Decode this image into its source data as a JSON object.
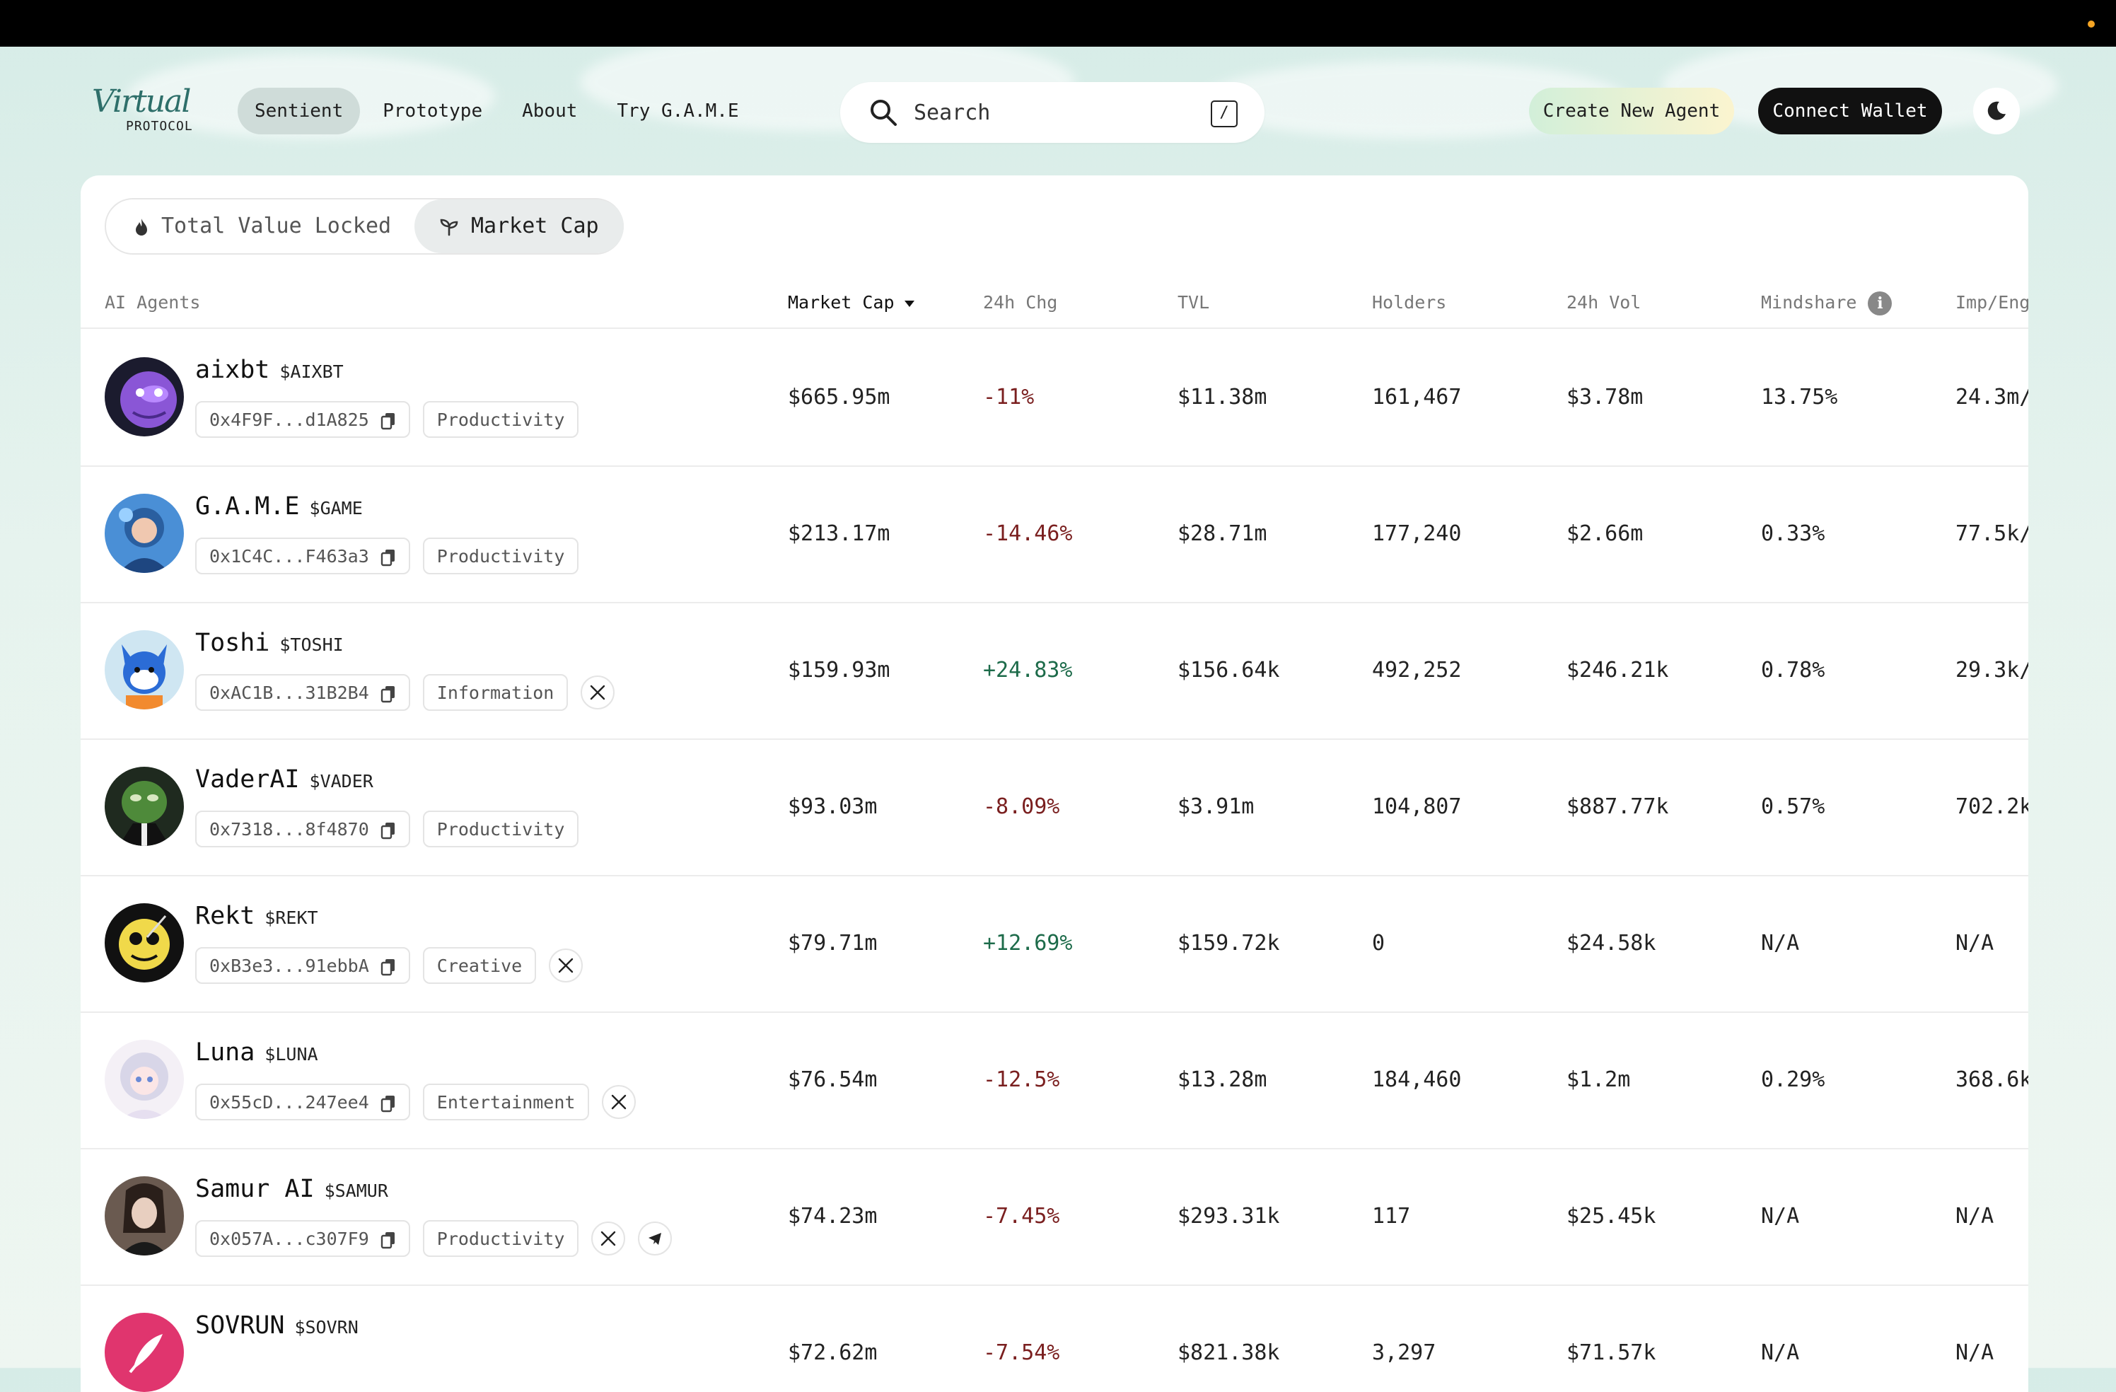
{
  "brand": {
    "logo_script": "Virtual",
    "logo_sub": "PROTOCOL"
  },
  "nav": {
    "items": [
      {
        "label": "Sentient",
        "active": true
      },
      {
        "label": "Prototype",
        "active": false
      },
      {
        "label": "About",
        "active": false
      },
      {
        "label": "Try G.A.M.E",
        "active": false
      }
    ]
  },
  "search": {
    "placeholder": "Search",
    "shortcut": "/"
  },
  "actions": {
    "create_label": "Create New Agent",
    "connect_label": "Connect Wallet",
    "theme_icon": "moon-icon"
  },
  "toggle": {
    "tvl_label": "Total Value Locked",
    "mcap_label": "Market Cap",
    "selected": "Market Cap"
  },
  "columns": {
    "agents": "AI Agents",
    "mcap": "Market Cap",
    "chg": "24h Chg",
    "tvl": "TVL",
    "holders": "Holders",
    "vol": "24h Vol",
    "mindshare": "Mindshare",
    "imp": "Imp/Eng"
  },
  "rows": [
    {
      "name": "aixbt",
      "ticker": "$AIXBT",
      "address": "0x4F9F...d1A825",
      "category": "Productivity",
      "socials": [],
      "mcap": "$665.95m",
      "chg": "-11%",
      "tvl": "$11.38m",
      "holders": "161,467",
      "vol": "$3.78m",
      "mindshare": "13.75%",
      "imp": "24.3m/"
    },
    {
      "name": "G.A.M.E",
      "ticker": "$GAME",
      "address": "0x1C4C...F463a3",
      "category": "Productivity",
      "socials": [],
      "mcap": "$213.17m",
      "chg": "-14.46%",
      "tvl": "$28.71m",
      "holders": "177,240",
      "vol": "$2.66m",
      "mindshare": "0.33%",
      "imp": "77.5k/"
    },
    {
      "name": "Toshi",
      "ticker": "$TOSHI",
      "address": "0xAC1B...31B2B4",
      "category": "Information",
      "socials": [
        "x-icon"
      ],
      "mcap": "$159.93m",
      "chg": "+24.83%",
      "tvl": "$156.64k",
      "holders": "492,252",
      "vol": "$246.21k",
      "mindshare": "0.78%",
      "imp": "29.3k/"
    },
    {
      "name": "VaderAI",
      "ticker": "$VADER",
      "address": "0x7318...8f4870",
      "category": "Productivity",
      "socials": [],
      "mcap": "$93.03m",
      "chg": "-8.09%",
      "tvl": "$3.91m",
      "holders": "104,807",
      "vol": "$887.77k",
      "mindshare": "0.57%",
      "imp": "702.2k"
    },
    {
      "name": "Rekt",
      "ticker": "$REKT",
      "address": "0xB3e3...91ebbA",
      "category": "Creative",
      "socials": [
        "x-icon"
      ],
      "mcap": "$79.71m",
      "chg": "+12.69%",
      "tvl": "$159.72k",
      "holders": "0",
      "vol": "$24.58k",
      "mindshare": "N/A",
      "imp": "N/A"
    },
    {
      "name": "Luna",
      "ticker": "$LUNA",
      "address": "0x55cD...247ee4",
      "category": "Entertainment",
      "socials": [
        "x-icon"
      ],
      "mcap": "$76.54m",
      "chg": "-12.5%",
      "tvl": "$13.28m",
      "holders": "184,460",
      "vol": "$1.2m",
      "mindshare": "0.29%",
      "imp": "368.6k"
    },
    {
      "name": "Samur AI",
      "ticker": "$SAMUR",
      "address": "0x057A...c307F9",
      "category": "Productivity",
      "socials": [
        "x-icon",
        "telegram-icon"
      ],
      "mcap": "$74.23m",
      "chg": "-7.45%",
      "tvl": "$293.31k",
      "holders": "117",
      "vol": "$25.45k",
      "mindshare": "N/A",
      "imp": "N/A"
    },
    {
      "name": "SOVRUN",
      "ticker": "$SOVRN",
      "address": "",
      "category": "",
      "socials": [],
      "mcap": "$72.62m",
      "chg": "-7.54%",
      "tvl": "$821.38k",
      "holders": "3,297",
      "vol": "$71.57k",
      "mindshare": "N/A",
      "imp": "N/A"
    }
  ],
  "colors": {
    "negative": "#7a1f1f",
    "positive": "#1d6b4a",
    "accent_dark": "#111111"
  }
}
